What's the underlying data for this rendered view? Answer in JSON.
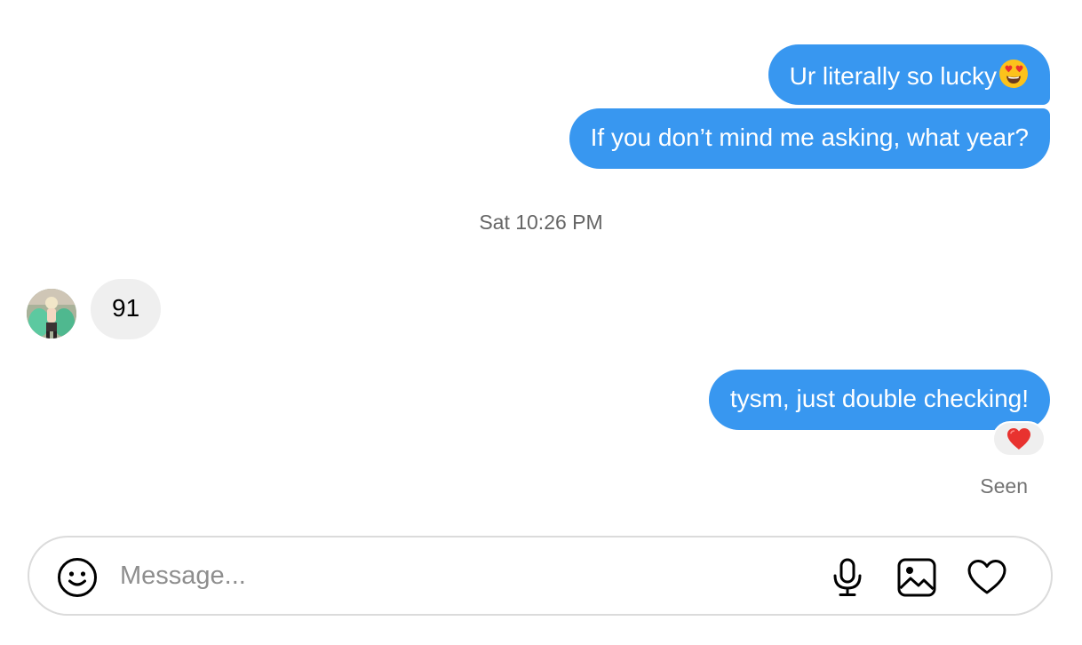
{
  "messages": {
    "outgoing_1": "Ur literally so lucky",
    "outgoing_2": "If you don’t mind me asking, what year?",
    "timestamp": "Sat 10:26 PM",
    "incoming_1": "91",
    "outgoing_3": "tysm, just double checking!",
    "seen": "Seen"
  },
  "composer": {
    "placeholder": "Message..."
  },
  "icons": {
    "emoji_in_message": "heart-eyes-emoji-icon",
    "reaction": "red-heart-icon",
    "composer_emoji": "smiley-icon",
    "composer_mic": "microphone-icon",
    "composer_photo": "photo-icon",
    "composer_like": "heart-outline-icon"
  },
  "colors": {
    "outgoing_bubble": "#3897f0",
    "incoming_bubble": "#efefef",
    "reaction_heart": "#e8322f"
  }
}
